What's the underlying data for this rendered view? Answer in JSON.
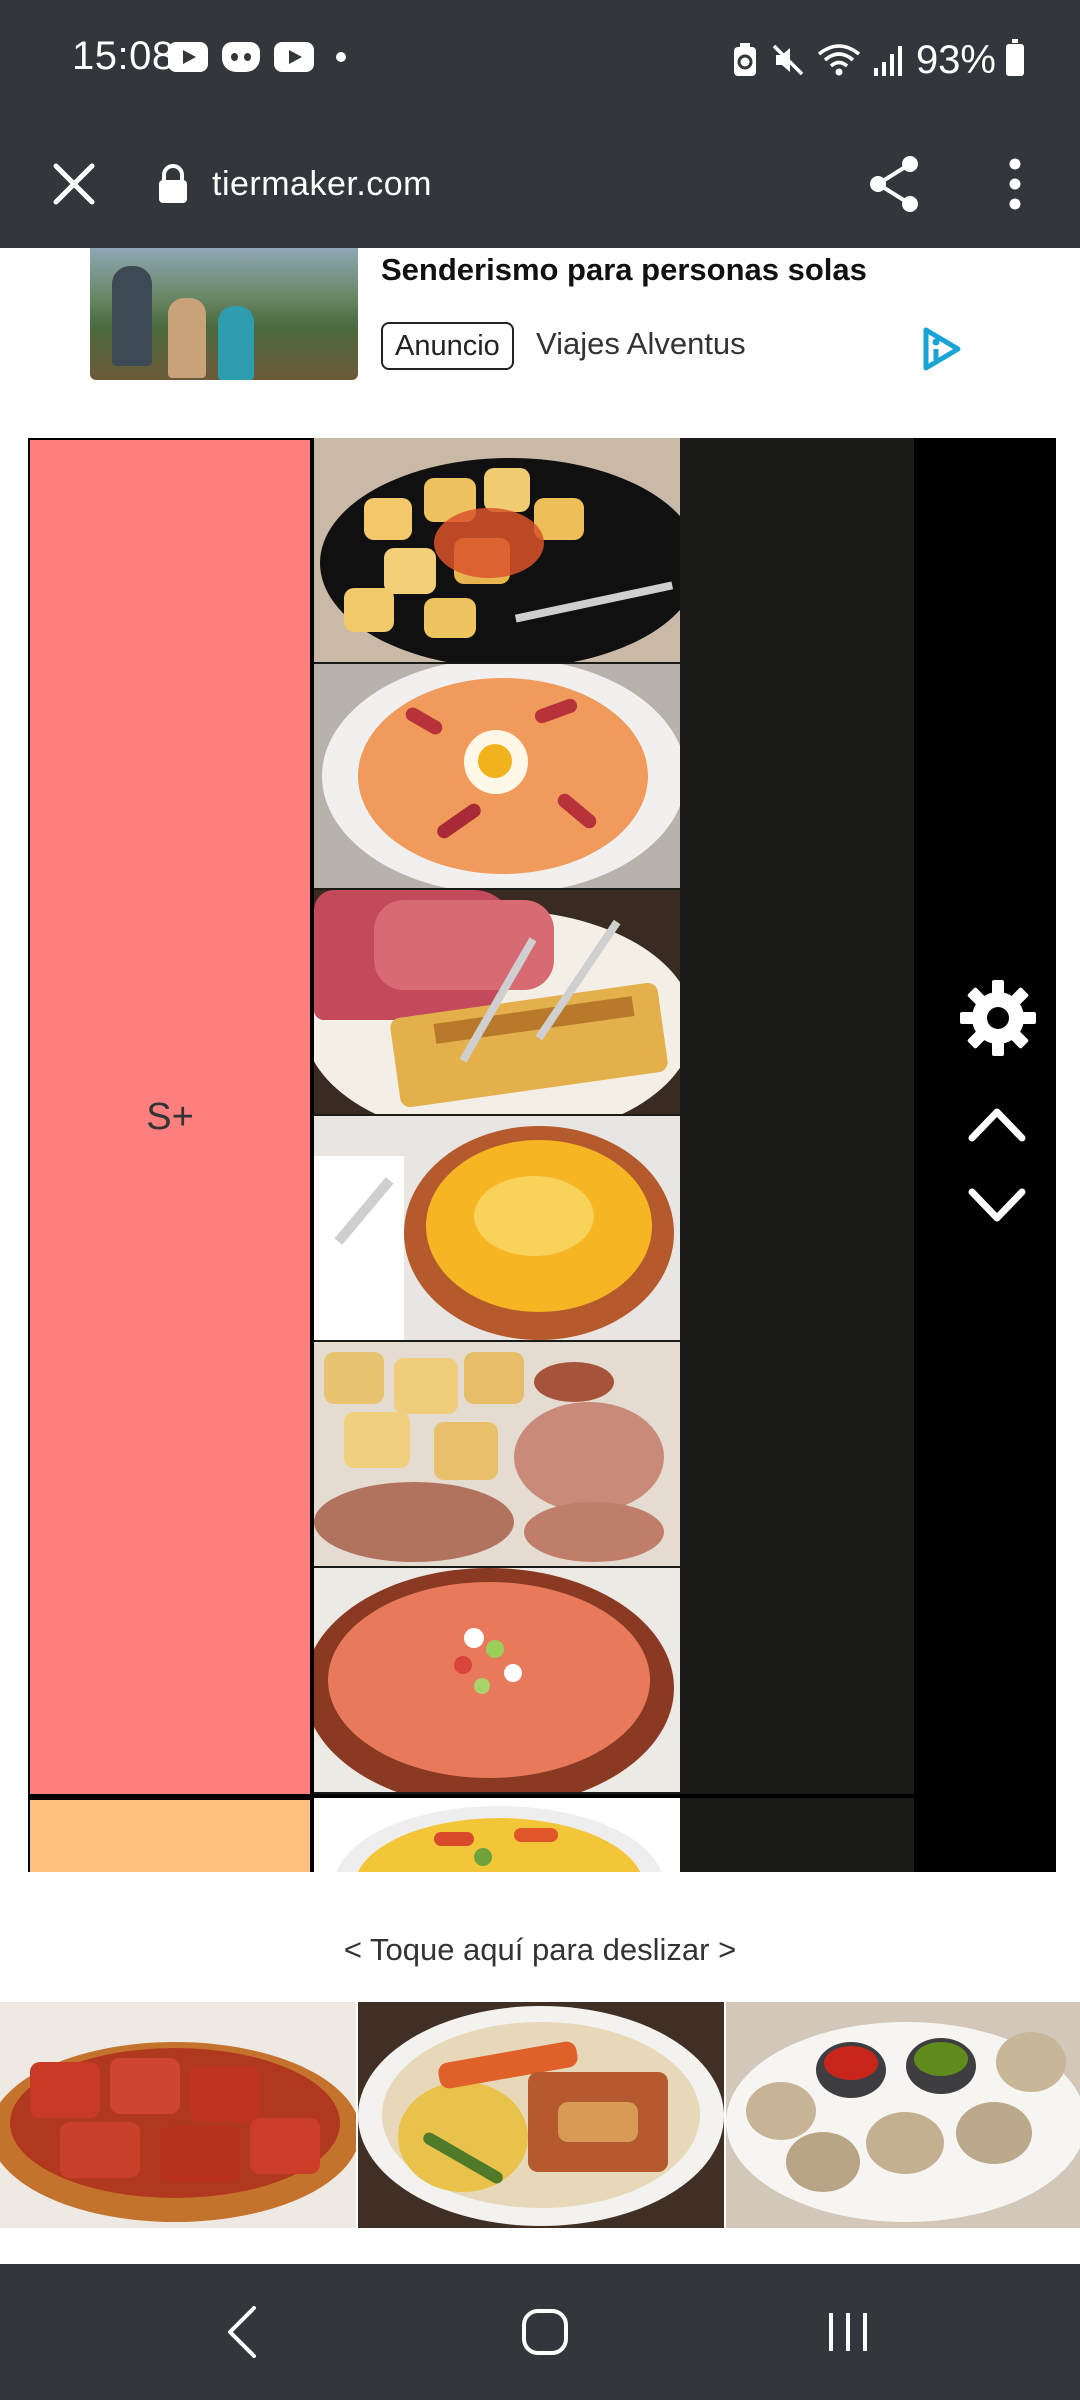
{
  "status_bar": {
    "time": "15:08",
    "battery": "93%",
    "left_icons": [
      "youtube-icon",
      "discord-icon",
      "youtube-icon",
      "notification-dot-icon"
    ],
    "right_icons": [
      "battery-saver-icon",
      "mute-icon",
      "wifi-icon",
      "signal-icon",
      "battery-icon"
    ]
  },
  "toolbar": {
    "url": "tiermaker.com",
    "icons": [
      "close-icon",
      "lock-icon",
      "share-icon",
      "more-vert-icon"
    ]
  },
  "ad": {
    "title": "Senderismo para personas solas",
    "badge": "Anuncio",
    "advertiser": "Viajes Alventus",
    "icons": [
      "adchoices-icon"
    ]
  },
  "tiers": [
    {
      "label": "S+",
      "color": "#ff7f7f",
      "items": [
        "patatas bravas",
        "salmorejo",
        "jamón y empanada",
        "crema catalana",
        "pulpo a la gallega",
        "gazpacho"
      ]
    },
    {
      "label": "",
      "color": "#ffbf7f",
      "items": [
        "paella"
      ]
    }
  ],
  "tier_controls": [
    "gear-icon",
    "chevron-up-icon",
    "chevron-down-icon"
  ],
  "swipe_hint": "< Toque aquí para deslizar >",
  "carousel_items": [
    "callos",
    "cocido",
    "papas arrugadas con mojo"
  ],
  "navbar": [
    "back-icon",
    "home-icon",
    "recents-icon"
  ],
  "colors": {
    "chrome": "#33363b",
    "tier_s_plus": "#ff7f7f",
    "tier_a": "#ffbf7f",
    "tier_bg": "#1a1a17"
  }
}
